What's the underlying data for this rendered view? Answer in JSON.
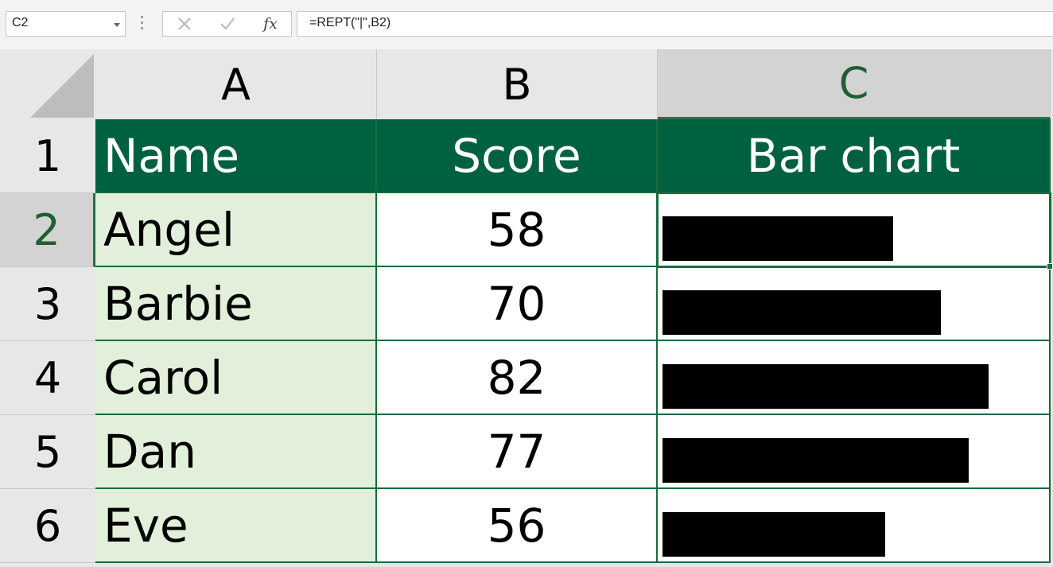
{
  "formula_bar": {
    "name_box": "C2",
    "formula": "=REPT(\"|\",B2)",
    "cancel_icon": "close-icon",
    "enter_icon": "check-icon",
    "fx_label": "fx"
  },
  "columns": [
    "A",
    "B",
    "C"
  ],
  "rows": [
    "1",
    "2",
    "3",
    "4",
    "5",
    "6"
  ],
  "header": {
    "name": "Name",
    "score": "Score",
    "bar": "Bar chart"
  },
  "data": [
    {
      "name": "Angel",
      "score": "58",
      "bar_units": 58
    },
    {
      "name": "Barbie",
      "score": "70",
      "bar_units": 70
    },
    {
      "name": "Carol",
      "score": "82",
      "bar_units": 82
    },
    {
      "name": "Dan",
      "score": "77",
      "bar_units": 77
    },
    {
      "name": "Eve",
      "score": "56",
      "bar_units": 56
    }
  ],
  "colors": {
    "header_bg": "#006140",
    "name_bg": "#e2efda",
    "accent": "#217346",
    "bar": "#000000"
  }
}
